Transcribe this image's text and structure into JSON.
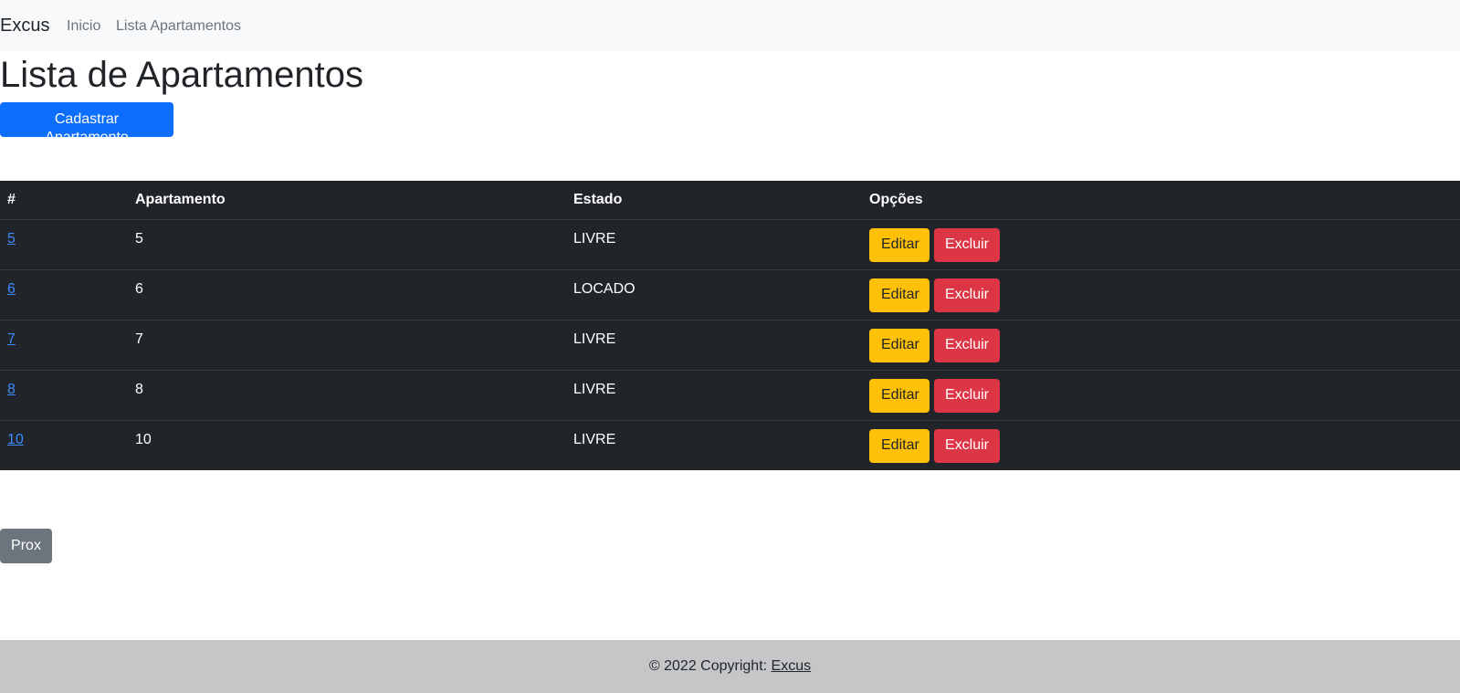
{
  "navbar": {
    "brand": "Excus",
    "links": [
      "Inicio",
      "Lista Apartamentos"
    ]
  },
  "page": {
    "title": "Lista de Apartamentos",
    "add_button": "Cadastrar Apartamento",
    "next_button": "Prox"
  },
  "table": {
    "headers": [
      "#",
      "Apartamento",
      "Estado",
      "Opções"
    ],
    "rows": [
      {
        "id": "5",
        "apartamento": "5",
        "estado": "LIVRE"
      },
      {
        "id": "6",
        "apartamento": "6",
        "estado": "LOCADO"
      },
      {
        "id": "7",
        "apartamento": "7",
        "estado": "LIVRE"
      },
      {
        "id": "8",
        "apartamento": "8",
        "estado": "LIVRE"
      },
      {
        "id": "10",
        "apartamento": "10",
        "estado": "LIVRE"
      }
    ],
    "edit_label": "Editar",
    "delete_label": "Excluir"
  },
  "footer": {
    "prefix": "© 2022 Copyright: ",
    "link": "Excus"
  },
  "colors": {
    "primary": "#0d6efd",
    "warning": "#ffc107",
    "danger": "#dc3545",
    "secondary": "#6c757d",
    "table_dark": "#212529",
    "footer_bg": "#c5c6c8"
  }
}
